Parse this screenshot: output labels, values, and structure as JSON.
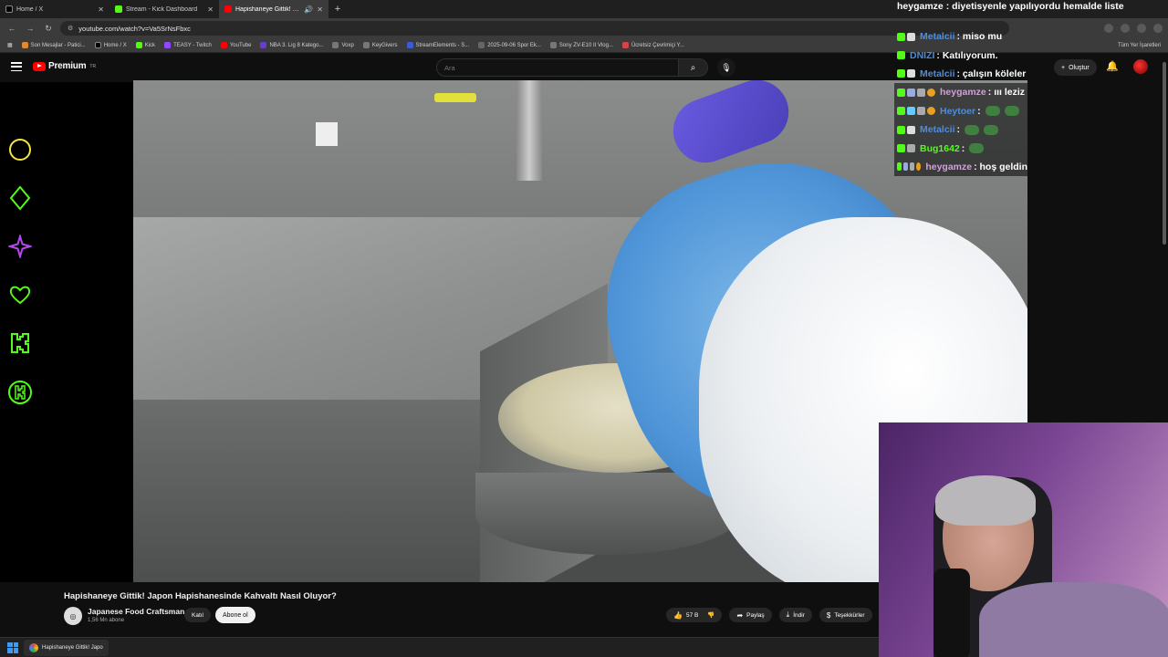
{
  "browser": {
    "tabs": [
      {
        "label": "Home / X",
        "color": "#000000"
      },
      {
        "label": "Stream - Kick Dashboard",
        "color": "#53fc18"
      },
      {
        "label": "Hapishaneye Gittik! Japon",
        "color": "#ff0000"
      }
    ],
    "url": "youtube.com/watch?v=Va5SrNsFbxc",
    "bookmarks": [
      {
        "label": "Son Mesajlar - Patici...",
        "color": "#e08a2f"
      },
      {
        "label": "Home / X",
        "color": "#000000"
      },
      {
        "label": "Kick",
        "color": "#53fc18"
      },
      {
        "label": "TEASY - Twitch",
        "color": "#9146ff"
      },
      {
        "label": "YouTube",
        "color": "#ff0000"
      },
      {
        "label": "NBA 3. Lig 8 Katego...",
        "color": "#6a3ad6"
      },
      {
        "label": "Voxp",
        "color": "#444444"
      },
      {
        "label": "KeyGivers",
        "color": "#444444"
      },
      {
        "label": "StreamElements - S...",
        "color": "#3a5bd6"
      },
      {
        "label": "2025-09-06 Spor Ek...",
        "color": "#666666"
      },
      {
        "label": "Sony ZV-E10 II Vlog...",
        "color": "#444444"
      },
      {
        "label": "Ücretsiz Çevrimiçi Y...",
        "color": "#d64545"
      }
    ],
    "bookmarks_right": "Tüm Yer İşaretleri"
  },
  "youtube": {
    "logo_text": "Premium",
    "logo_sup": "TR",
    "search_placeholder": "Ara",
    "create_label": "Oluştur"
  },
  "chat": {
    "top_line": "heygamze : diyetisyenle yapılıyordu hemalde liste",
    "messages": [
      {
        "user": "Metalcii",
        "text": " : miso mu",
        "color": "#4d8ddc"
      },
      {
        "user": "DNIZI",
        "text": " : Katılıyorum.",
        "color": "#4d8ddc"
      },
      {
        "user": "Metalcii",
        "text": " : çalışın köleler",
        "color": "#4d8ddc"
      },
      {
        "user": "heygamze",
        "text": " : ııı leziz",
        "color": "#d69de0"
      },
      {
        "user": "Heytoer",
        "text": " :",
        "color": "#4d8ddc"
      },
      {
        "user": "Metalcii",
        "text": " :",
        "color": "#4d8ddc"
      },
      {
        "user": "Bug1642",
        "text": " :",
        "color": "#53fc18"
      },
      {
        "user": "heygamze",
        "text": " : hoş geldin",
        "color": "#d69de0"
      }
    ]
  },
  "video": {
    "title": "Hapishaneye Gittik! Japon Hapishanesinde Kahvaltı Nasıl Oluyor?",
    "channel": "Japanese Food Craftsman",
    "subscribers": "1,56 Mn abone",
    "join_label": "Katıl",
    "subscribe_label": "Abone ol",
    "likes": "57 B",
    "share_label": "Paylaş",
    "download_label": "İndir",
    "thanks_label": "Teşekkürler"
  },
  "taskbar": {
    "item_label": "Hapishaneye Gittik! Japo"
  },
  "sidebar_icons": [
    {
      "name": "circle-icon",
      "color": "#f5e642"
    },
    {
      "name": "diamond-icon",
      "color": "#53fc18"
    },
    {
      "name": "star-icon",
      "color": "#b44af0"
    },
    {
      "name": "heart-icon",
      "color": "#53fc18"
    },
    {
      "name": "kick-k-icon",
      "color": "#53fc18"
    },
    {
      "name": "kick-circle-icon",
      "color": "#53fc18"
    }
  ]
}
